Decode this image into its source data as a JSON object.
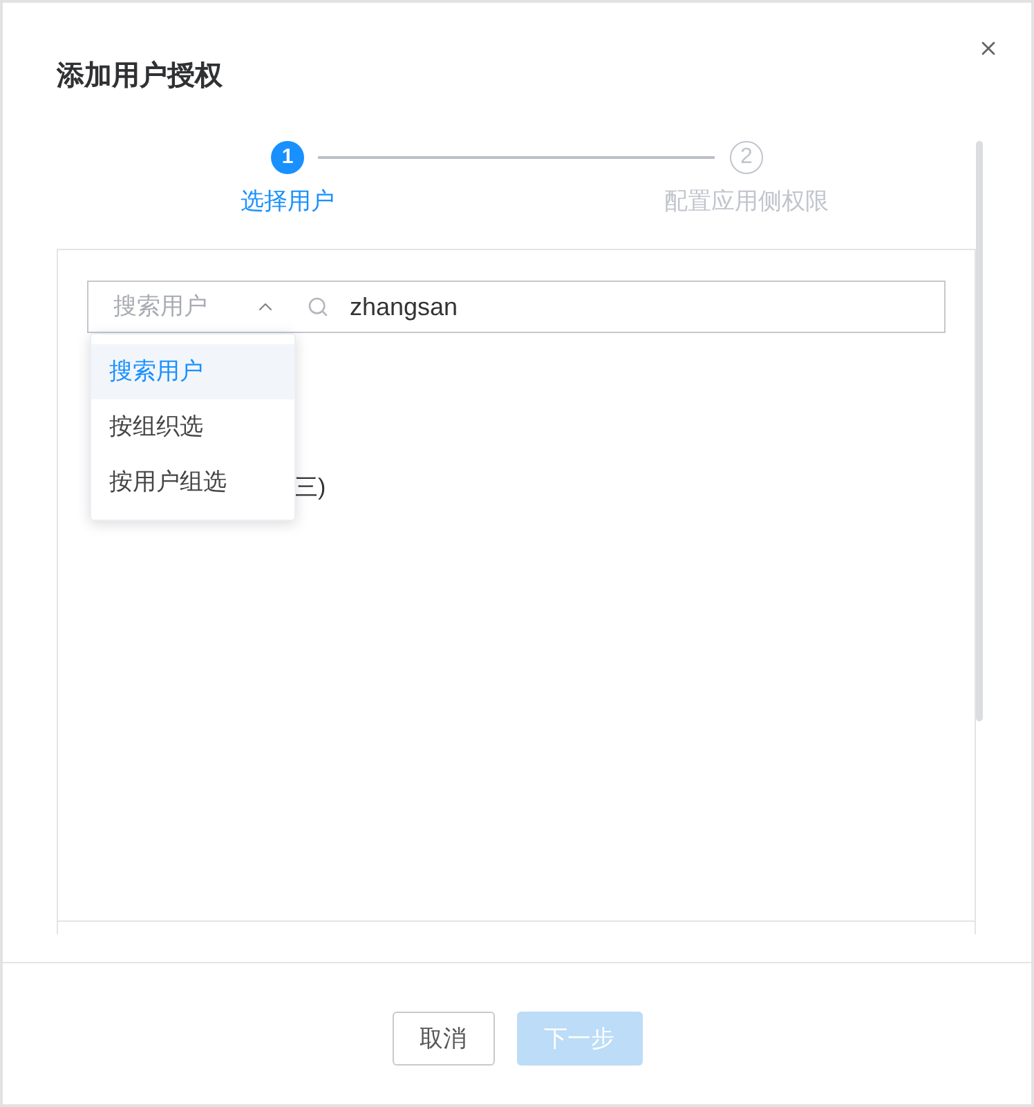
{
  "dialog": {
    "title": "添加用户授权"
  },
  "steps": [
    {
      "number": "1",
      "label": "选择用户",
      "active": true
    },
    {
      "number": "2",
      "label": "配置应用侧权限",
      "active": false
    }
  ],
  "search": {
    "mode_select": {
      "value": "搜索用户",
      "expanded": true
    },
    "query": {
      "value": "zhangsan"
    }
  },
  "mode_options": [
    {
      "label": "搜索用户",
      "selected": true
    },
    {
      "label": "按组织选",
      "selected": false
    },
    {
      "label": "按用户组选",
      "selected": false
    }
  ],
  "results": [
    {
      "label": "三)"
    }
  ],
  "buttons": [
    {
      "label": "取消",
      "kind": "secondary",
      "disabled": false
    },
    {
      "label": "下一步",
      "kind": "primary",
      "disabled": true
    }
  ]
}
